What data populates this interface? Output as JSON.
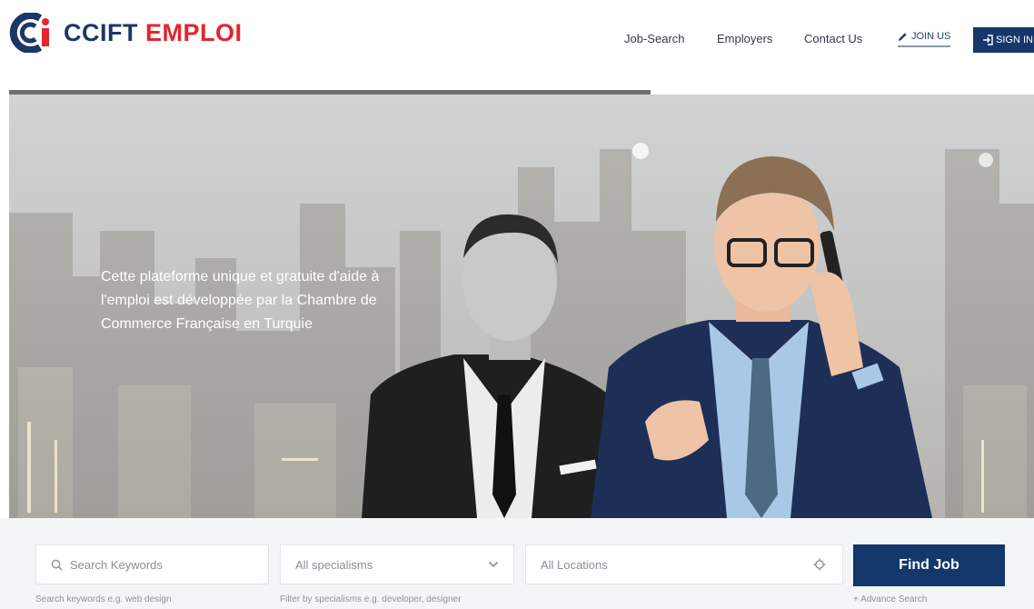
{
  "brand": {
    "name_part1": "CCIFT",
    "name_part2": "EMPLOI",
    "colors": {
      "navy": "#1a3768",
      "red": "#e3262c"
    }
  },
  "nav": {
    "items": [
      {
        "label": "Job-Search"
      },
      {
        "label": "Employers"
      },
      {
        "label": "Contact Us"
      }
    ],
    "join_label": "JOIN US",
    "signin_label": "SIGN IN",
    "icons": {
      "join": "pencil-icon",
      "signin": "sign-in-icon"
    }
  },
  "hero": {
    "text": "Cette plateforme unique et gratuite d'aide à l'emploi est développée par la Chambre de Commerce Française en Turquie"
  },
  "search": {
    "keywords_placeholder": "Search Keywords",
    "keywords_hint": "Search keywords e.g. web design",
    "specialism_selected": "All specialisms",
    "specialism_hint": "Filter by specialisms e.g. developer, designer",
    "location_placeholder": "All Locations",
    "find_label": "Find Job",
    "advance_label": "+ Advance Search",
    "icons": {
      "keywords": "search-icon",
      "specialism": "chevron-down-icon",
      "location": "crosshair-icon"
    }
  }
}
